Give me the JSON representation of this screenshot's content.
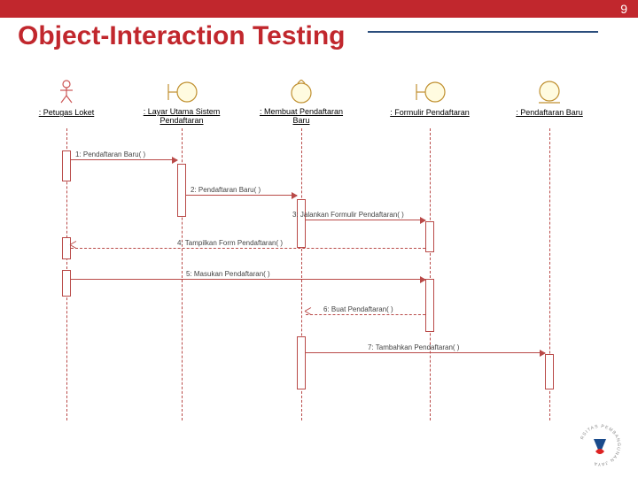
{
  "page_number": "9",
  "title": "Object-Interaction Testing",
  "lifelines": [
    {
      "label": ": Petugas\nLoket"
    },
    {
      "label": ": Layar Utama Sistem\nPendaftaran"
    },
    {
      "label": ": Membuat\nPendaftaran Baru"
    },
    {
      "label": ": Formulir Pendaftaran"
    },
    {
      "label": ": Pendaftaran\nBaru"
    }
  ],
  "messages": [
    {
      "label": "1: Pendaftaran Baru( )"
    },
    {
      "label": "2: Pendaftaran Baru( )"
    },
    {
      "label": "3: Jalankan Formulir Pendaftaran( )"
    },
    {
      "label": "4: Tampilkan Form Pendaftaran( )"
    },
    {
      "label": "5: Masukan Pendaftaran( )"
    },
    {
      "label": "6: Buat Pendaftaran( )"
    },
    {
      "label": "7: Tambahkan Pendaftaran( )"
    }
  ],
  "logo_text": "RSITAS PEMBANGUNAN JAYA"
}
